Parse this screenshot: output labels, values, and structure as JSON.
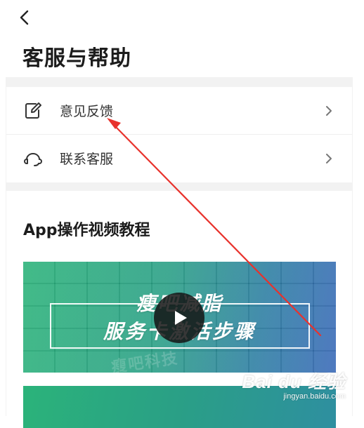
{
  "header": {
    "back_icon": "chevron-left-icon",
    "title": "客服与帮助"
  },
  "menu": {
    "items": [
      {
        "icon": "edit-icon",
        "label": "意见反馈",
        "chevron": "chevron-right-icon"
      },
      {
        "icon": "headset-icon",
        "label": "联系客服",
        "chevron": "chevron-right-icon"
      }
    ]
  },
  "tutorial": {
    "title": "App操作视频教程",
    "video": {
      "line1": "瘦吧减脂",
      "line2": "服务卡激活步骤",
      "watermark": "瘦吧科技",
      "play_icon": "play-icon"
    }
  },
  "watermark": {
    "logo": "Bai du 经验",
    "url": "jingyan.baidu.com"
  },
  "colors": {
    "annotation_arrow": "#e8322c",
    "card_green": "#2bb37a",
    "card_blue": "#3a6ab8",
    "section_gap": "#f2f2f2"
  }
}
